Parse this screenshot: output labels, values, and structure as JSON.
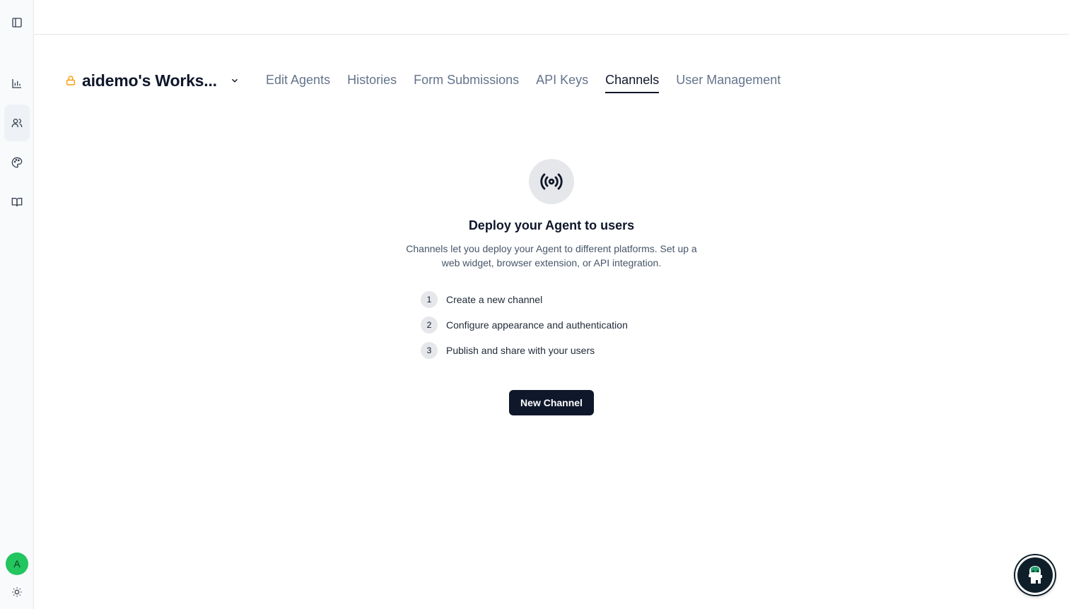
{
  "sidebar": {
    "items": [
      {
        "icon": "panel-toggle-icon"
      },
      {
        "icon": "bar-chart-icon"
      },
      {
        "icon": "users-icon",
        "active": true
      },
      {
        "icon": "palette-icon"
      },
      {
        "icon": "book-icon"
      }
    ],
    "avatar_initial": "A",
    "theme_icon": "sun-icon"
  },
  "workspace": {
    "name": "aidemo's Works...",
    "lock_color": "#f59e0b"
  },
  "tabs": [
    {
      "label": "Edit Agents"
    },
    {
      "label": "Histories"
    },
    {
      "label": "Form Submissions"
    },
    {
      "label": "API Keys"
    },
    {
      "label": "Channels",
      "active": true
    },
    {
      "label": "User Management"
    }
  ],
  "empty_state": {
    "icon": "broadcast-icon",
    "title": "Deploy your Agent to users",
    "description": "Channels let you deploy your Agent to different platforms. Set up a web widget, browser extension, or API integration.",
    "steps": [
      {
        "num": "1",
        "text": "Create a new channel"
      },
      {
        "num": "2",
        "text": "Configure appearance and authentication"
      },
      {
        "num": "3",
        "text": "Publish and share with your users"
      }
    ],
    "button_label": "New Channel"
  },
  "chat_launcher": {
    "icon": "chatbot-mascot-icon"
  }
}
